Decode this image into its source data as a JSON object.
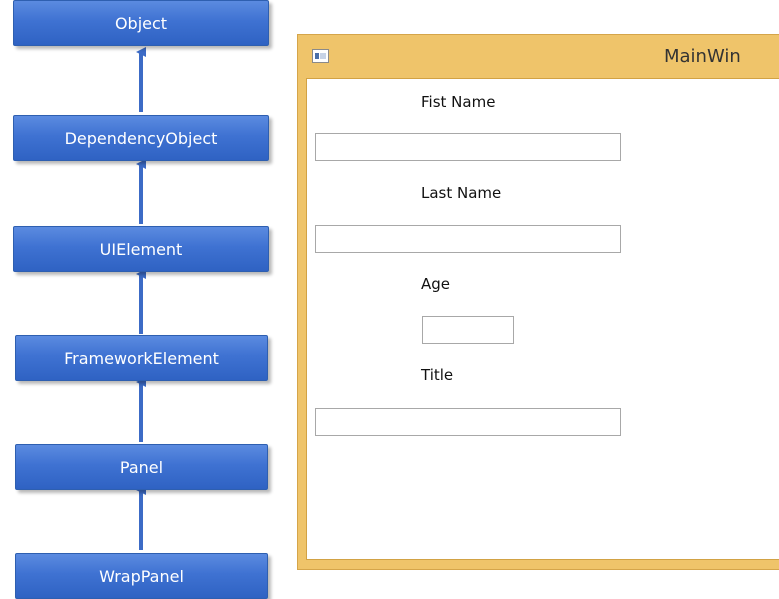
{
  "hierarchy": {
    "nodes": [
      "Object",
      "DependencyObject",
      "UIElement",
      "FrameworkElement",
      "Panel",
      "WrapPanel"
    ]
  },
  "window": {
    "title": "MainWin",
    "fields": [
      {
        "label": "Fist Name",
        "value": ""
      },
      {
        "label": "Last Name",
        "value": ""
      },
      {
        "label": "Age",
        "value": ""
      },
      {
        "label": "Title",
        "value": ""
      }
    ]
  },
  "colors": {
    "box_fill": "#3f72d2",
    "box_border": "#2e5fb0",
    "arrow": "#3c6bc6",
    "window_frame": "#efc46a"
  }
}
